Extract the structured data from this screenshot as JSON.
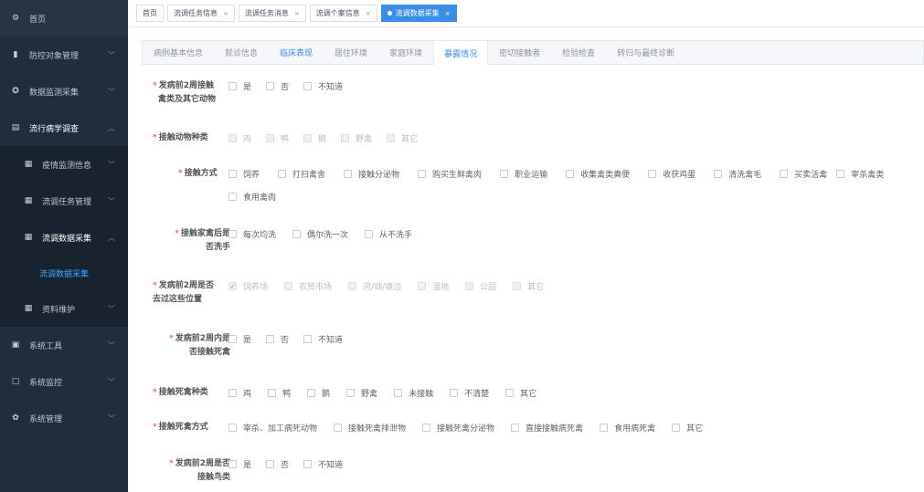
{
  "sidebar": {
    "items": [
      {
        "label": "首页",
        "icon": "dashboard-icon"
      },
      {
        "label": "防控对象管理",
        "icon": "document-icon"
      },
      {
        "label": "数据监测采集",
        "icon": "gear-icon"
      },
      {
        "label": "流行病学调查",
        "icon": "file-icon"
      },
      {
        "label": "疫情监测信息",
        "icon": "grid-icon"
      },
      {
        "label": "流调任务管理",
        "icon": "grid-icon"
      },
      {
        "label": "流调数据采集",
        "icon": "grid-icon"
      },
      {
        "label": "流调数据采集"
      },
      {
        "label": "资料维护",
        "icon": "grid-icon"
      },
      {
        "label": "系统工具",
        "icon": "tools-icon"
      },
      {
        "label": "系统监控",
        "icon": "monitor-icon"
      },
      {
        "label": "系统管理",
        "icon": "gear-icon"
      }
    ]
  },
  "tags": [
    {
      "label": "首页"
    },
    {
      "label": "流调任务信息"
    },
    {
      "label": "流调任务消息"
    },
    {
      "label": "流调个案信息"
    },
    {
      "label": "流调数据采集"
    }
  ],
  "tabs": [
    "病例基本信息",
    "就诊信息",
    "临床表现",
    "居住环境",
    "家庭环境",
    "暴露情况",
    "密切接触者",
    "检验检查",
    "转归与最终诊断"
  ],
  "form": {
    "q1": {
      "label1": "发病前2周接触",
      "label2": "禽类及其它动物",
      "options": [
        "是",
        "否",
        "不知道"
      ]
    },
    "q2": {
      "label1": "接触动物种类",
      "options": [
        "鸡",
        "鸭",
        "鹅",
        "野禽",
        "其它"
      ]
    },
    "q3": {
      "label1": "接触方式",
      "options": [
        "饲养",
        "打扫禽舍",
        "接触分泌物",
        "购买生鲜禽肉",
        "职业运输",
        "收集禽类粪便",
        "收获鸡蛋",
        "清洗禽毛",
        "买卖活禽",
        "宰杀禽类",
        "食用禽肉"
      ]
    },
    "q4": {
      "label1": "接触家禽后是",
      "label2": "否洗手",
      "options": [
        "每次均洗",
        "偶尔洗一次",
        "从不洗手"
      ]
    },
    "q5": {
      "label1": "发病前2周是否",
      "label2": "去过这些位置",
      "options": [
        "饲养场",
        "农贸市场",
        "河/湖/塘边",
        "湿地",
        "公园",
        "其它"
      ]
    },
    "q6": {
      "label1": "发病前2周内是",
      "label2": "否接触死禽",
      "options": [
        "是",
        "否",
        "不知道"
      ]
    },
    "q7": {
      "label1": "接触死禽种类",
      "options": [
        "鸡",
        "鸭",
        "鹅",
        "野禽",
        "未接触",
        "不清楚",
        "其它"
      ]
    },
    "q8": {
      "label1": "接触死禽方式",
      "options": [
        "宰杀、加工病死动物",
        "接触死禽排泄物",
        "接触死禽分泌物",
        "直接接触病死禽",
        "食用病死禽",
        "其它"
      ]
    },
    "q9": {
      "label1": "发病前2周是否",
      "label2": "接触鸟类",
      "options": [
        "是",
        "否",
        "不知道"
      ]
    }
  }
}
